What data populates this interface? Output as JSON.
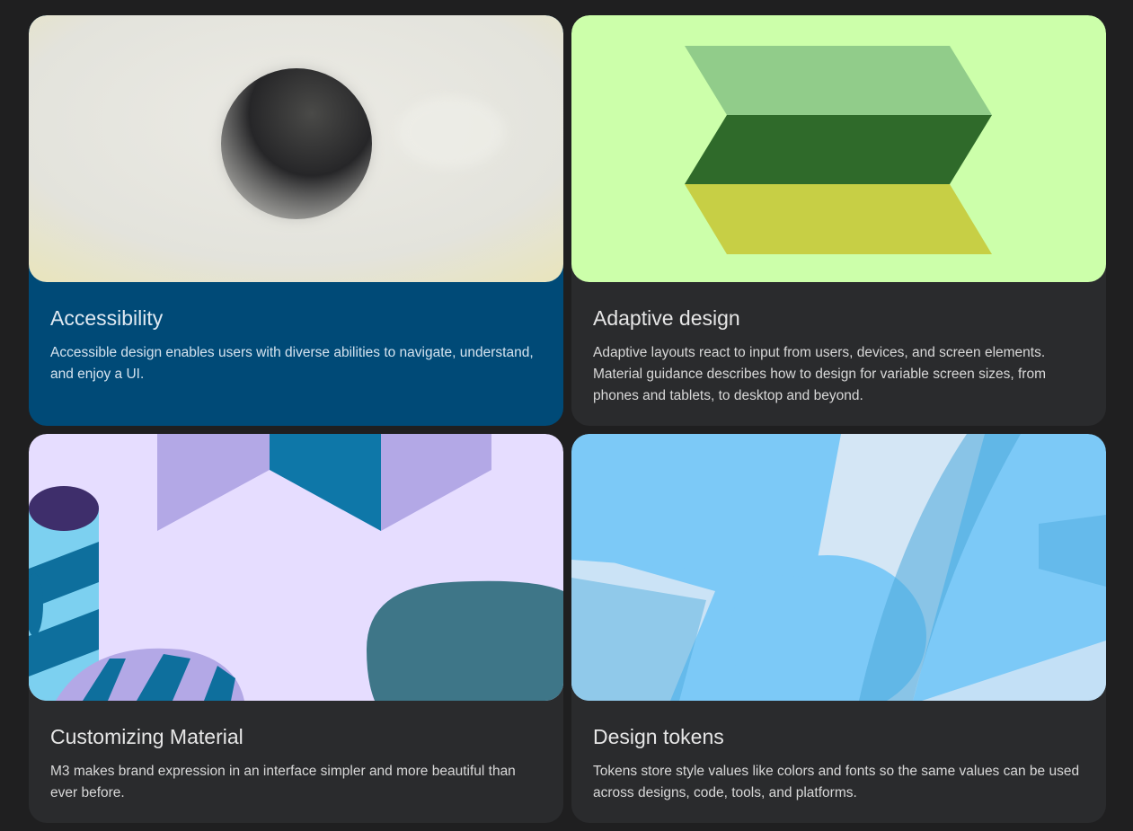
{
  "cards": [
    {
      "title": "Accessibility",
      "description": "Accessible design enables users with diverse abilities to navigate, understand, and enjoy a UI.",
      "color": "#004a77",
      "art": "sphere-illustration"
    },
    {
      "title": "Adaptive design",
      "description": "Adaptive layouts react to input from users, devices, and screen elements. Material guidance describes how to design for variable screen sizes, from phones and tablets, to desktop and beyond.",
      "color": "#2a2b2d",
      "art": "zigzag-stripes-illustration"
    },
    {
      "title": "Customizing Material",
      "description": "M3 makes brand expression in an interface simpler and more beautiful than ever before.",
      "color": "#2a2b2d",
      "art": "geometric-shapes-illustration"
    },
    {
      "title": "Design tokens",
      "description": "Tokens store style values like colors and fonts so the same values can be used across designs, code, tools, and platforms.",
      "color": "#2a2b2d",
      "art": "blue-strokes-illustration"
    }
  ],
  "colors": {
    "background": "#1f1f20",
    "accessibility_card": "#004a77",
    "card_surface": "#2a2b2d"
  }
}
